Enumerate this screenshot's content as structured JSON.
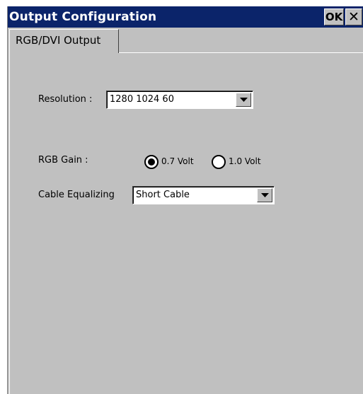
{
  "window": {
    "title": "Output Configuration",
    "ok_label": "OK",
    "close_glyph": "✕"
  },
  "tabs": [
    {
      "label": "RGB/DVI Output",
      "active": true
    }
  ],
  "form": {
    "resolution": {
      "label": "Resolution :",
      "value": "1280 1024 60"
    },
    "rgb_gain": {
      "label": "RGB Gain :",
      "options": [
        {
          "label": "0.7 Volt",
          "selected": true
        },
        {
          "label": "1.0 Volt",
          "selected": false
        }
      ]
    },
    "cable_equalizing": {
      "label": "Cable Equalizing",
      "value": "Short Cable"
    }
  },
  "colors": {
    "titlebar": "#0b246a",
    "face": "#c0c0c0"
  }
}
